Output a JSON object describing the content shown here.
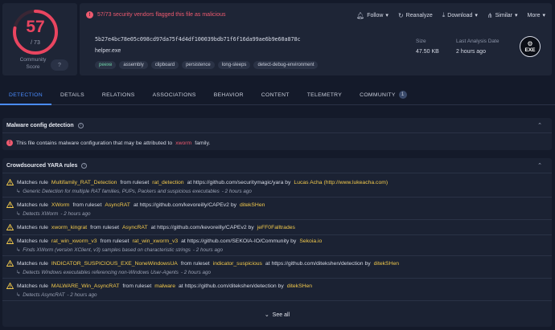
{
  "score": {
    "detected": "57",
    "total": "/ 73",
    "ratio": 0.78,
    "community_label_1": "Community",
    "community_label_2": "Score",
    "community_icon": "question-icon"
  },
  "alert": {
    "text": "57/73 security vendors flagged this file as malicious",
    "icon": "alert-circle-icon"
  },
  "actions": [
    {
      "label": "Follow",
      "icon": "bell-icon",
      "suffix": "▾"
    },
    {
      "label": "Reanalyze",
      "icon": "refresh-icon",
      "suffix": ""
    },
    {
      "label": "Download",
      "icon": "download-icon",
      "suffix": "▾"
    },
    {
      "label": "Similar",
      "icon": "similar-icon",
      "suffix": "▾"
    },
    {
      "label": "More",
      "icon": "",
      "suffix": "▾"
    }
  ],
  "file": {
    "hash": "5b27e4bc78e05c098cd97da75f4d4df100039bdb71f6f16da99ae6b9e60a878c",
    "name": "helper.exe",
    "tags": [
      "peexe",
      "assembly",
      "clipboard",
      "persistence",
      "long-sleeps",
      "detect-debug-environment"
    ],
    "size_label": "Size",
    "size": "47.50 KB",
    "date_label": "Last Analysis Date",
    "date": "2 hours ago",
    "type_badge": "EXE"
  },
  "tabs": [
    {
      "label": "DETECTION",
      "active": true
    },
    {
      "label": "DETAILS"
    },
    {
      "label": "RELATIONS"
    },
    {
      "label": "ASSOCIATIONS"
    },
    {
      "label": "BEHAVIOR"
    },
    {
      "label": "CONTENT"
    },
    {
      "label": "TELEMETRY"
    },
    {
      "label": "COMMUNITY",
      "count": "1"
    }
  ],
  "malware_config": {
    "title": "Malware config detection",
    "pre": "This file contains malware configuration that may be attributed to",
    "family": "xworm",
    "post": "family."
  },
  "yara": {
    "title": "Crowdsourced YARA rules",
    "see_all": "See all",
    "rules": [
      {
        "p1": "Matches rule",
        "rule": "Multifamily_RAT_Detection",
        "p2": "from ruleset",
        "ruleset": "rat_detection",
        "p3": "at https://github.com/securitymagic/yara by",
        "author": "Lucas Acha (http://www.lukeacha.com)",
        "desc": "Generic Detection for multiple RAT families, PUPs, Packers and suspicious executables",
        "time": "- 2 hours ago"
      },
      {
        "p1": "Matches rule",
        "rule": "XWorm",
        "p2": "from ruleset",
        "ruleset": "AsyncRAT",
        "p3": "at https://github.com/kevoreilly/CAPEv2 by",
        "author": "ditekSHen",
        "desc": "Detects XWorm",
        "time": "- 2 hours ago"
      },
      {
        "p1": "Matches rule",
        "rule": "xworm_kingrat",
        "p2": "from ruleset",
        "ruleset": "AsyncRAT",
        "p3": "at https://github.com/kevoreilly/CAPEv2 by",
        "author": "jeFF0Falltrades",
        "desc": "",
        "time": ""
      },
      {
        "p1": "Matches rule",
        "rule": "rat_win_xworm_v3",
        "p2": "from ruleset",
        "ruleset": "rat_win_xworm_v3",
        "p3": "at https://github.com/SEKOIA-IO/Community by",
        "author": "Sekoia.io",
        "desc": "Finds XWorm (version XClient, v3) samples based on characteristic strings",
        "time": "- 2 hours ago"
      },
      {
        "p1": "Matches rule",
        "rule": "INDICATOR_SUSPICIOUS_EXE_NoneWindowsUA",
        "p2": "from ruleset",
        "ruleset": "indicator_suspicious",
        "p3": "at https://github.com/ditekshen/detection by",
        "author": "ditekSHen",
        "desc": "Detects Windows executables referencing non-Windows User-Agents",
        "time": "- 2 hours ago"
      },
      {
        "p1": "Matches rule",
        "rule": "MALWARE_Win_AsyncRAT",
        "p2": "from ruleset",
        "ruleset": "malware",
        "p3": "at https://github.com/ditekshen/detection by",
        "author": "ditekSHen",
        "desc": "Detects AsyncRAT",
        "time": "- 2 hours ago"
      }
    ]
  }
}
